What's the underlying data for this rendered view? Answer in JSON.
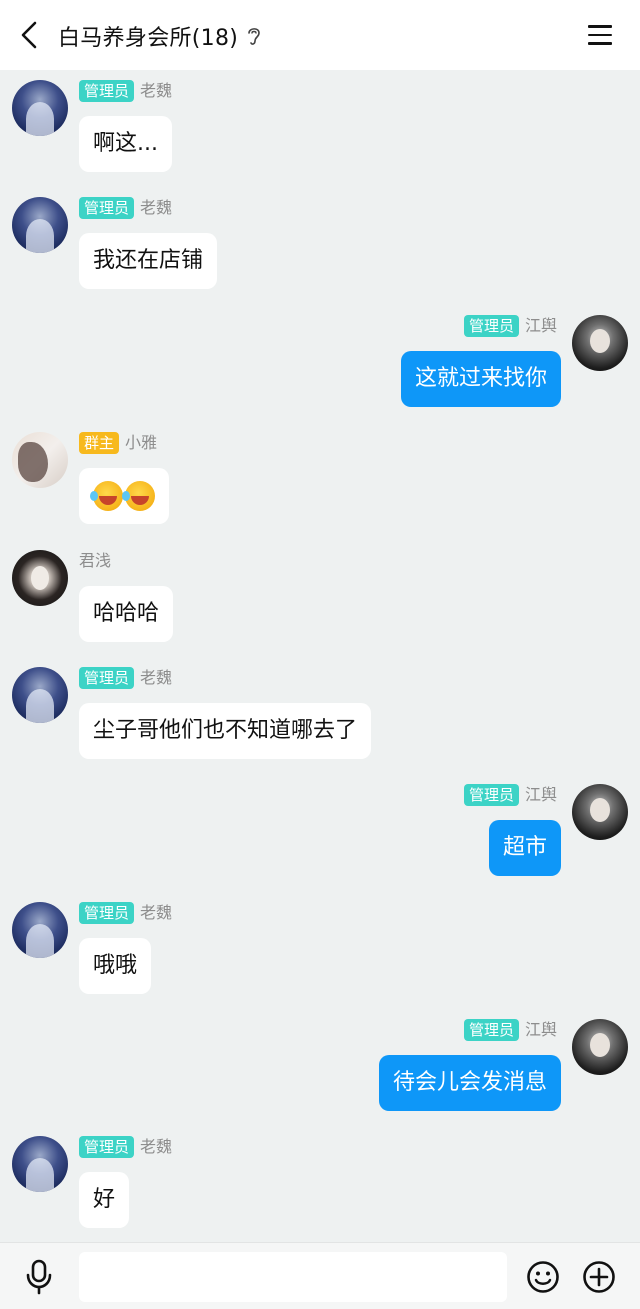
{
  "header": {
    "title": "白马养身会所(18)",
    "back_icon": "chevron-left-icon",
    "ear_icon": "ear-icon",
    "menu_icon": "hamburger-menu-icon"
  },
  "messages": [
    {
      "side": "left",
      "badge": "管理员",
      "sender": "老魏",
      "text": "啊这..."
    },
    {
      "side": "left",
      "badge": "管理员",
      "sender": "老魏",
      "text": "我还在店铺"
    },
    {
      "side": "right",
      "badge": "管理员",
      "sender": "江舆",
      "text": "这就过来找你"
    },
    {
      "side": "left",
      "badge": "群主",
      "sender": "小雅",
      "emoji": "laughing-tears-emoji x2"
    },
    {
      "side": "left",
      "badge": "",
      "sender": "君浅",
      "text": "哈哈哈"
    },
    {
      "side": "left",
      "badge": "管理员",
      "sender": "老魏",
      "text": "尘子哥他们也不知道哪去了"
    },
    {
      "side": "right",
      "badge": "管理员",
      "sender": "江舆",
      "text": "超市"
    },
    {
      "side": "left",
      "badge": "管理员",
      "sender": "老魏",
      "text": "哦哦"
    },
    {
      "side": "right",
      "badge": "管理员",
      "sender": "江舆",
      "text": "待会儿会发消息"
    },
    {
      "side": "left",
      "badge": "管理员",
      "sender": "老魏",
      "text": "好"
    }
  ],
  "input_bar": {
    "placeholder": "",
    "mic_icon": "microphone-icon",
    "emoji_icon": "smiley-icon",
    "plus_icon": "plus-circle-icon"
  },
  "colors": {
    "admin_badge": "#3cd3c6",
    "owner_badge": "#f7b91d",
    "self_bubble": "#0e97f8",
    "background": "#eef1f1"
  }
}
